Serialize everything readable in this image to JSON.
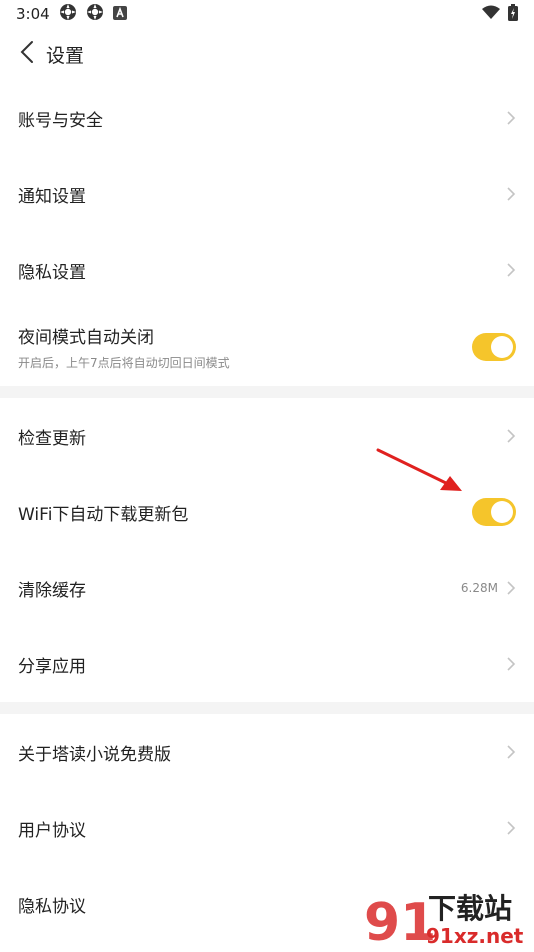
{
  "status_bar": {
    "time": "3:04",
    "left_icons": [
      "gear-notification-icon",
      "gear-notification-icon",
      "a-notification-icon"
    ],
    "right_icons": [
      "wifi-icon",
      "battery-icon"
    ]
  },
  "header": {
    "title": "设置",
    "back_icon": "chevron-left-icon"
  },
  "groups": [
    {
      "items": [
        {
          "label": "账号与安全",
          "type": "link"
        },
        {
          "label": "通知设置",
          "type": "link"
        },
        {
          "label": "隐私设置",
          "type": "link"
        },
        {
          "label": "夜间模式自动关闭",
          "subtitle": "开启后，上午7点后将自动切回日间模式",
          "type": "toggle",
          "on": true
        }
      ]
    },
    {
      "items": [
        {
          "label": "检查更新",
          "type": "link"
        },
        {
          "label": "WiFi下自动下载更新包",
          "type": "toggle",
          "on": true
        },
        {
          "label": "清除缓存",
          "value": "6.28M",
          "type": "link"
        },
        {
          "label": "分享应用",
          "type": "link"
        }
      ]
    },
    {
      "items": [
        {
          "label": "关于塔读小说免费版",
          "type": "link"
        },
        {
          "label": "用户协议",
          "type": "link"
        },
        {
          "label": "隐私协议",
          "type": "link"
        }
      ]
    }
  ],
  "watermark": {
    "logo_text": "91",
    "title": "下载站",
    "domain": "91xz.net"
  },
  "colors": {
    "toggle_on": "#f5c52b",
    "divider": "#f4f4f4",
    "arrow": "#e0211f",
    "watermark_red": "#d92b2b"
  }
}
